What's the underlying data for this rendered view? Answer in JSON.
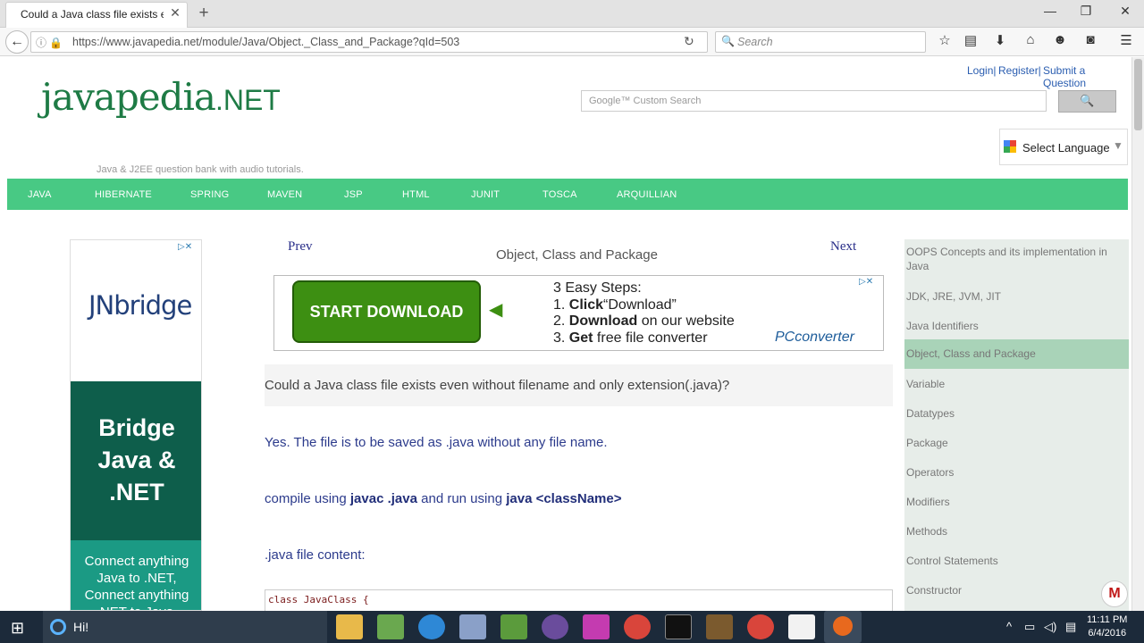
{
  "browser": {
    "tab_title": "Could a Java class file exists ev...",
    "url": "https://www.javapedia.net/module/Java/Object._Class_and_Package?qId=503",
    "search_placeholder": "Search"
  },
  "site": {
    "logo_main": "javapedia",
    "logo_suffix": ".NET",
    "tagline": "Java & J2EE question bank with audio tutorials.",
    "top_links": [
      "Login|",
      "Register|",
      "Submit a Question"
    ],
    "google_placeholder": "Google™ Custom Search",
    "search_button_icon": "search-icon",
    "language_label": "Select Language",
    "nav": [
      "JAVA",
      "HIBERNATE",
      "SPRING",
      "MAVEN",
      "JSP",
      "HTML",
      "JUNIT",
      "TOSCA",
      "ARQUILLIAN"
    ]
  },
  "left_ad": {
    "brand": "JNbridge",
    "headline_lines": [
      "Bridge",
      "Java &",
      ".NET"
    ],
    "subtext_lines": [
      "Connect anything",
      "Java to .NET,",
      "Connect anything",
      "NET to Java"
    ]
  },
  "content": {
    "prev": "Prev",
    "next": "Next",
    "title": "Object, Class and Package",
    "ad_button": "START DOWNLOAD",
    "ad_steps_title": "3 Easy Steps:",
    "ad_steps": [
      {
        "num": "1.",
        "bold": "Click",
        "rest": "“Download”"
      },
      {
        "num": "2.",
        "bold": "Download",
        "rest": "on our website"
      },
      {
        "num": "3.",
        "bold": "Get",
        "rest": "free file converter"
      }
    ],
    "ad_brand": "PCconverter",
    "question": "Could a Java class file exists even without filename and only extension(.java)?",
    "answer1": "Yes. The file is to be saved as .java without any file name.",
    "answer2_pre": "compile using ",
    "answer2_cmd1": "javac .java",
    "answer2_mid": " and run using ",
    "answer2_cmd2": "java <className>",
    "answer3": ".java file content:",
    "code_line": "class JavaClass {"
  },
  "sidebar": {
    "items": [
      "OOPS Concepts and its implementation in Java",
      "JDK, JRE, JVM, JIT",
      "Java Identifiers",
      "Object, Class and Package",
      "Variable",
      "Datatypes",
      "Package",
      "Operators",
      "Modifiers",
      "Methods",
      "Control Statements",
      "Constructor"
    ],
    "active_index": 3,
    "active_color": "#a9d3b8"
  },
  "taskbar": {
    "cortana_text": "Hi!",
    "time": "11:11 PM",
    "date": "6/4/2016"
  },
  "colors": {
    "nav_green": "#48c984",
    "logo_green": "#1e7b45",
    "link_blue": "#2a5db0",
    "text_blue": "#2c3b8c"
  }
}
